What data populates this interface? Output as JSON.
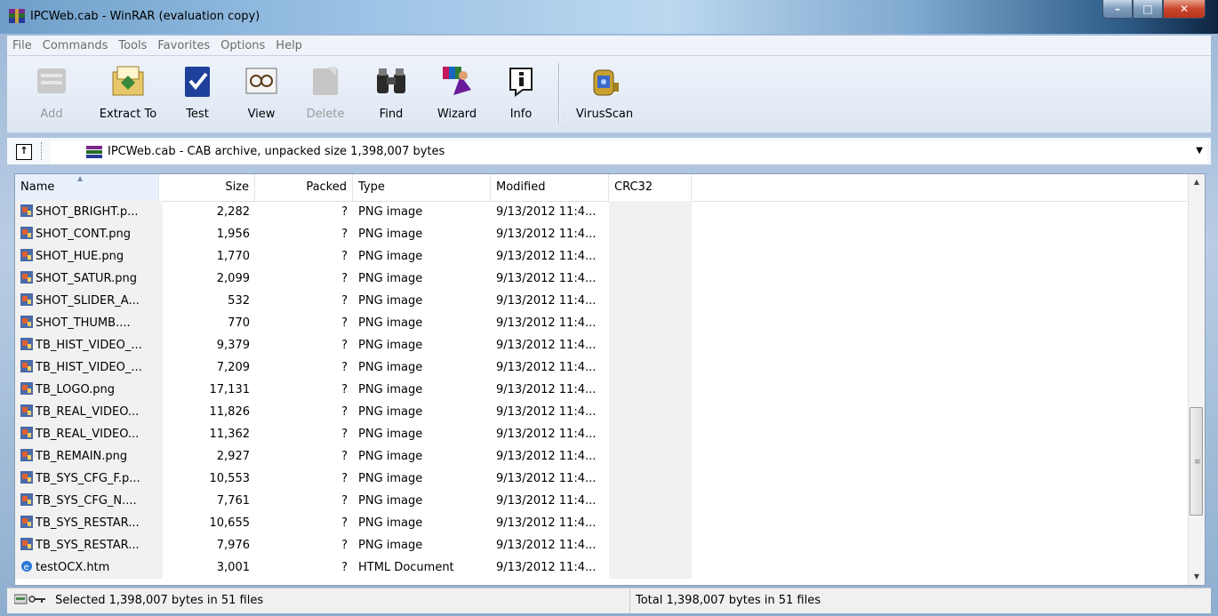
{
  "window": {
    "title": "IPCWeb.cab - WinRAR (evaluation copy)",
    "controls": [
      "minimize",
      "maximize",
      "close"
    ]
  },
  "menu": [
    "File",
    "Commands",
    "Tools",
    "Favorites",
    "Options",
    "Help"
  ],
  "toolbar": {
    "buttons": [
      {
        "label": "Add",
        "icon": "add-archive-icon",
        "enabled": false
      },
      {
        "label": "Extract To",
        "icon": "extract-to-icon",
        "enabled": true
      },
      {
        "label": "Test",
        "icon": "test-icon",
        "enabled": true
      },
      {
        "label": "View",
        "icon": "view-icon",
        "enabled": true
      },
      {
        "label": "Delete",
        "icon": "delete-icon",
        "enabled": false
      },
      {
        "label": "Find",
        "icon": "find-binoculars-icon",
        "enabled": true
      },
      {
        "label": "Wizard",
        "icon": "wizard-icon",
        "enabled": true
      },
      {
        "label": "Info",
        "icon": "info-icon",
        "enabled": true
      },
      {
        "label": "VirusScan",
        "icon": "virus-scan-icon",
        "enabled": true
      }
    ]
  },
  "address": {
    "text": "IPCWeb.cab - CAB archive, unpacked size 1,398,007 bytes"
  },
  "columns": [
    "Name",
    "Size",
    "Packed",
    "Type",
    "Modified",
    "CRC32"
  ],
  "sorted_column": "Name",
  "files": [
    {
      "name": "SHOT_BRIGHT.p...",
      "size": "2,282",
      "packed": "?",
      "type": "PNG image",
      "modified": "9/13/2012 11:4...",
      "icon": "png-file-icon"
    },
    {
      "name": "SHOT_CONT.png",
      "size": "1,956",
      "packed": "?",
      "type": "PNG image",
      "modified": "9/13/2012 11:4...",
      "icon": "png-file-icon"
    },
    {
      "name": "SHOT_HUE.png",
      "size": "1,770",
      "packed": "?",
      "type": "PNG image",
      "modified": "9/13/2012 11:4...",
      "icon": "png-file-icon"
    },
    {
      "name": "SHOT_SATUR.png",
      "size": "2,099",
      "packed": "?",
      "type": "PNG image",
      "modified": "9/13/2012 11:4...",
      "icon": "png-file-icon"
    },
    {
      "name": "SHOT_SLIDER_A...",
      "size": "532",
      "packed": "?",
      "type": "PNG image",
      "modified": "9/13/2012 11:4...",
      "icon": "png-file-icon"
    },
    {
      "name": "SHOT_THUMB....",
      "size": "770",
      "packed": "?",
      "type": "PNG image",
      "modified": "9/13/2012 11:4...",
      "icon": "png-file-icon"
    },
    {
      "name": "TB_HIST_VIDEO_...",
      "size": "9,379",
      "packed": "?",
      "type": "PNG image",
      "modified": "9/13/2012 11:4...",
      "icon": "png-file-icon"
    },
    {
      "name": "TB_HIST_VIDEO_...",
      "size": "7,209",
      "packed": "?",
      "type": "PNG image",
      "modified": "9/13/2012 11:4...",
      "icon": "png-file-icon"
    },
    {
      "name": "TB_LOGO.png",
      "size": "17,131",
      "packed": "?",
      "type": "PNG image",
      "modified": "9/13/2012 11:4...",
      "icon": "png-file-icon"
    },
    {
      "name": "TB_REAL_VIDEO...",
      "size": "11,826",
      "packed": "?",
      "type": "PNG image",
      "modified": "9/13/2012 11:4...",
      "icon": "png-file-icon"
    },
    {
      "name": "TB_REAL_VIDEO...",
      "size": "11,362",
      "packed": "?",
      "type": "PNG image",
      "modified": "9/13/2012 11:4...",
      "icon": "png-file-icon"
    },
    {
      "name": "TB_REMAIN.png",
      "size": "2,927",
      "packed": "?",
      "type": "PNG image",
      "modified": "9/13/2012 11:4...",
      "icon": "png-file-icon"
    },
    {
      "name": "TB_SYS_CFG_F.p...",
      "size": "10,553",
      "packed": "?",
      "type": "PNG image",
      "modified": "9/13/2012 11:4...",
      "icon": "png-file-icon"
    },
    {
      "name": "TB_SYS_CFG_N....",
      "size": "7,761",
      "packed": "?",
      "type": "PNG image",
      "modified": "9/13/2012 11:4...",
      "icon": "png-file-icon"
    },
    {
      "name": "TB_SYS_RESTAR...",
      "size": "10,655",
      "packed": "?",
      "type": "PNG image",
      "modified": "9/13/2012 11:4...",
      "icon": "png-file-icon"
    },
    {
      "name": "TB_SYS_RESTAR...",
      "size": "7,976",
      "packed": "?",
      "type": "PNG image",
      "modified": "9/13/2012 11:4...",
      "icon": "png-file-icon"
    },
    {
      "name": "testOCX.htm",
      "size": "3,001",
      "packed": "?",
      "type": "HTML Document",
      "modified": "9/13/2012 11:4...",
      "icon": "html-file-icon"
    }
  ],
  "status": {
    "left": "Selected 1,398,007 bytes in 51 files",
    "right": "Total 1,398,007 bytes in 51 files"
  }
}
